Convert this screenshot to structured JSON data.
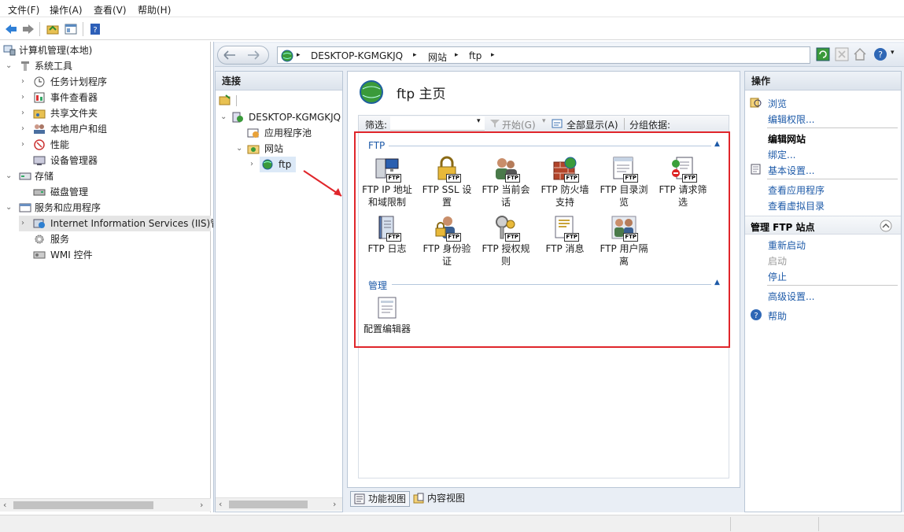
{
  "menu": [
    "文件(F)",
    "操作(A)",
    "查看(V)",
    "帮助(H)"
  ],
  "tree": {
    "root": "计算机管理(本地)",
    "system_tools": "系统工具",
    "task_scheduler": "任务计划程序",
    "event_viewer": "事件查看器",
    "shared_folders": "共享文件夹",
    "local_users": "本地用户和组",
    "performance": "性能",
    "device_manager": "设备管理器",
    "storage": "存储",
    "disk_management": "磁盘管理",
    "services_apps": "服务和应用程序",
    "iis": "Internet Information Services (IIS)管",
    "services": "服务",
    "wmi": "WMI 控件"
  },
  "breadcrumb": [
    "DESKTOP-KGMGKJQ",
    "网站",
    "ftp"
  ],
  "connections": {
    "title": "连接",
    "server": "DESKTOP-KGMGKJQ",
    "app_pools": "应用程序池",
    "sites": "网站",
    "ftp": "ftp"
  },
  "center": {
    "title": "ftp 主页",
    "filter_label": "筛选:",
    "start_label": "开始(G)",
    "show_all_label": "全部显示(A)",
    "group_by_label": "分组依据:",
    "group_ftp": "FTP",
    "group_manage": "管理",
    "features_ftp": [
      {
        "line1": "FTP IP 地址",
        "line2": "和域限制",
        "icon": "ip-restrictions-icon"
      },
      {
        "line1": "FTP SSL 设",
        "line2": "置",
        "icon": "ssl-lock-icon"
      },
      {
        "line1": "FTP 当前会",
        "line2": "话",
        "icon": "sessions-icon"
      },
      {
        "line1": "FTP 防火墙",
        "line2": "支持",
        "icon": "firewall-icon"
      },
      {
        "line1": "FTP 目录浏",
        "line2": "览",
        "icon": "directory-browsing-icon"
      },
      {
        "line1": "FTP 请求筛",
        "line2": "选",
        "icon": "request-filtering-icon"
      },
      {
        "line1": "FTP 日志",
        "line2": "",
        "icon": "logging-icon"
      },
      {
        "line1": "FTP 身份验",
        "line2": "证",
        "icon": "authentication-icon"
      },
      {
        "line1": "FTP 授权规",
        "line2": "则",
        "icon": "authorization-icon"
      },
      {
        "line1": "FTP 消息",
        "line2": "",
        "icon": "messages-icon"
      },
      {
        "line1": "FTP 用户隔",
        "line2": "离",
        "icon": "user-isolation-icon"
      }
    ],
    "features_manage": [
      {
        "line1": "配置编辑器",
        "line2": "",
        "icon": "config-editor-icon"
      }
    ]
  },
  "view_tabs": {
    "features": "功能视图",
    "content": "内容视图"
  },
  "actions": {
    "title": "操作",
    "browse": "浏览",
    "edit_permissions": "编辑权限...",
    "edit_site": "编辑网站",
    "bindings": "绑定...",
    "basic_settings": "基本设置...",
    "view_apps": "查看应用程序",
    "view_vdirs": "查看虚拟目录",
    "manage_ftp": "管理 FTP 站点",
    "restart": "重新启动",
    "start": "启动",
    "stop": "停止",
    "advanced": "高级设置...",
    "help": "帮助"
  },
  "colors": {
    "accent": "#1d5aa8",
    "highlight_box": "#e0262b",
    "arrow": "#e0262b"
  }
}
